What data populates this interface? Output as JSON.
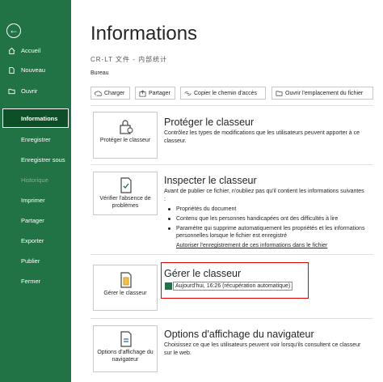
{
  "sidebar": {
    "back_icon": "back-arrow-icon",
    "items": [
      {
        "label": "Accueil",
        "icon": "home-icon"
      },
      {
        "label": "Nouveau",
        "icon": "new-file-icon"
      },
      {
        "label": "Ouvrir",
        "icon": "open-folder-icon"
      }
    ],
    "active": "Informations",
    "subitems": [
      "Enregistrer",
      "Enregistrer sous",
      "Historique",
      "Imprimer",
      "Partager",
      "Exporter",
      "Publier",
      "Fermer"
    ],
    "disabled": [
      "Historique"
    ],
    "color": "#217346",
    "active_color": "#0d5028"
  },
  "main": {
    "title": "Informations",
    "filename": "CR-LT 文件 - 内部统计",
    "location": "Bureau",
    "buttons": [
      {
        "label": "Charger",
        "icon": "upload-icon"
      },
      {
        "label": "Partager",
        "icon": "share-icon"
      },
      {
        "label": "Copier le chemin d'accès",
        "icon": "copy-link-icon"
      },
      {
        "label": "Ouvrir l'emplacement du fichier",
        "icon": "folder-icon"
      }
    ]
  },
  "sections": {
    "protect": {
      "button": "Protéger le classeur",
      "title": "Protéger le classeur",
      "text": "Contrôlez les types de modifications que les utilisateurs peuvent apporter à ce classeur."
    },
    "inspect": {
      "button": "Vérifier l'absence de problèmes",
      "title": "Inspecter le classeur",
      "text": "Avant de publier ce fichier, n'oubliez pas qu'il contient les informations suivantes :",
      "bullets": [
        "Propriétés du document",
        "Contenu que les personnes handicapées ont des difficultés à lire",
        "Paramètre qui supprime automatiquement les propriétés et les informations personnelles lorsque le fichier est enregistré"
      ],
      "link": "Autoriser l'enregistrement de ces informations dans le fichier"
    },
    "manage": {
      "button": "Gérer le classeur",
      "title": "Gérer le classeur",
      "version": "Aujourd'hui, 16:26 (récupération automatique)",
      "highlight_color": "#e00000"
    },
    "browser": {
      "button": "Options d'affichage du navigateur",
      "title": "Options d'affichage du navigateur",
      "text": "Choisissez ce que les utilisateurs peuvent voir lorsqu'ils consultent ce classeur sur le web."
    }
  }
}
